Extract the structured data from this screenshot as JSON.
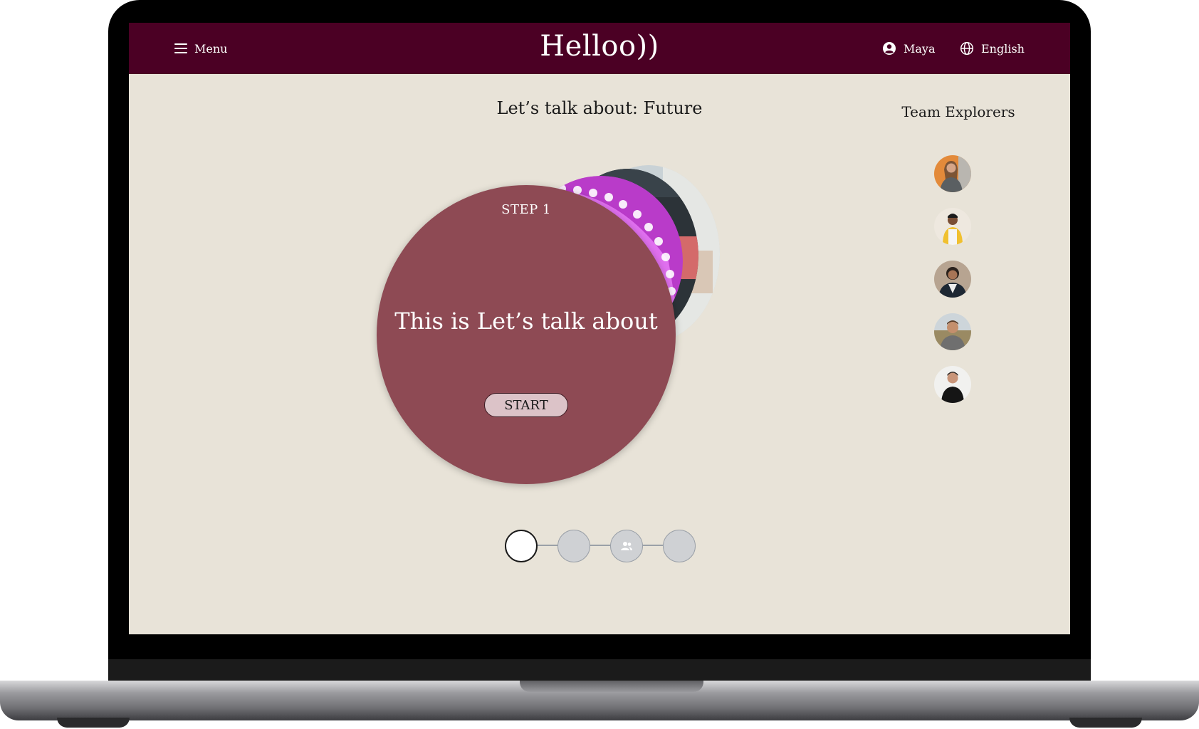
{
  "app": {
    "logo": "Helloo))"
  },
  "header": {
    "menu_label": "Menu",
    "user_name": "Maya",
    "language": "English"
  },
  "main": {
    "heading": "Let’s talk about: Future",
    "card": {
      "step_label": "STEP 1",
      "text": "This is Let’s talk about",
      "start_label": "START"
    },
    "stepper": {
      "total_steps": 4,
      "current_step": 1
    }
  },
  "team": {
    "title": "Team Explorers",
    "members": 5
  },
  "colors": {
    "header_bg": "#4b0024",
    "page_bg": "#e8e3d8",
    "card_bg": "#8e4a54",
    "start_button_bg": "#dcc3c8"
  }
}
